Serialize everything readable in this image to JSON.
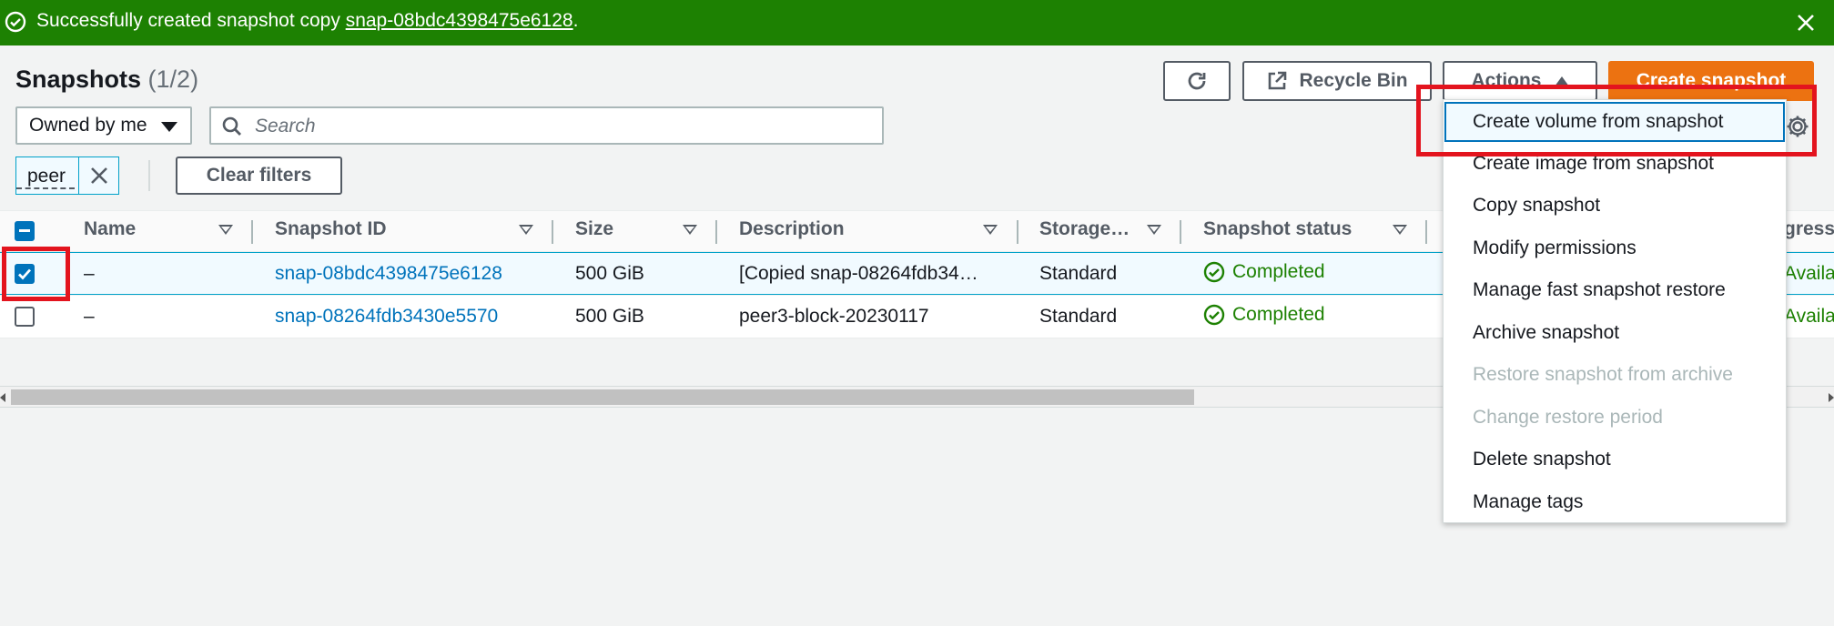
{
  "flash": {
    "message_prefix": "Successfully created snapshot copy ",
    "snapshot_link": "snap-08bdc4398475e6128",
    "message_suffix": ".",
    "status_icon": "check-circle-icon",
    "close_icon": "close-icon"
  },
  "header": {
    "title": "Snapshots",
    "count": "(1/2)",
    "recycle_bin_label": "Recycle Bin",
    "actions_label": "Actions",
    "create_label": "Create snapshot",
    "refresh_icon": "refresh-icon",
    "external_icon": "external-link-icon"
  },
  "filters": {
    "owner_select": "Owned by me",
    "search_placeholder": "Search",
    "token": "peer",
    "clear_label": "Clear filters"
  },
  "table": {
    "columns": [
      "Name",
      "Snapshot ID",
      "Size",
      "Description",
      "Storage…",
      "Snapshot status",
      "gress"
    ],
    "rows": [
      {
        "selected": true,
        "name": "–",
        "id": "snap-08bdc4398475e6128",
        "size": "500 GiB",
        "description": "[Copied snap-08264fdb34…",
        "storage": "Standard",
        "status": "Completed",
        "extra": "Availab"
      },
      {
        "selected": false,
        "name": "–",
        "id": "snap-08264fdb3430e5570",
        "size": "500 GiB",
        "description": "peer3-block-20230117",
        "storage": "Standard",
        "status": "Completed",
        "extra": "Availab"
      }
    ]
  },
  "actions_menu": {
    "items": [
      {
        "label": "Create volume from snapshot",
        "disabled": false,
        "highlighted": true
      },
      {
        "label": "Create image from snapshot",
        "disabled": false
      },
      {
        "label": "Copy snapshot",
        "disabled": false
      },
      {
        "label": "Modify permissions",
        "disabled": false
      },
      {
        "label": "Manage fast snapshot restore",
        "disabled": false
      },
      {
        "label": "Archive snapshot",
        "disabled": false
      },
      {
        "label": "Restore snapshot from archive",
        "disabled": true
      },
      {
        "label": "Change restore period",
        "disabled": true
      },
      {
        "label": "Delete snapshot",
        "disabled": false
      },
      {
        "label": "Manage tags",
        "disabled": false
      }
    ]
  },
  "colors": {
    "success": "#1d8102",
    "primary": "#ec7211",
    "link": "#0073bb",
    "annotation": "#e3141e"
  }
}
